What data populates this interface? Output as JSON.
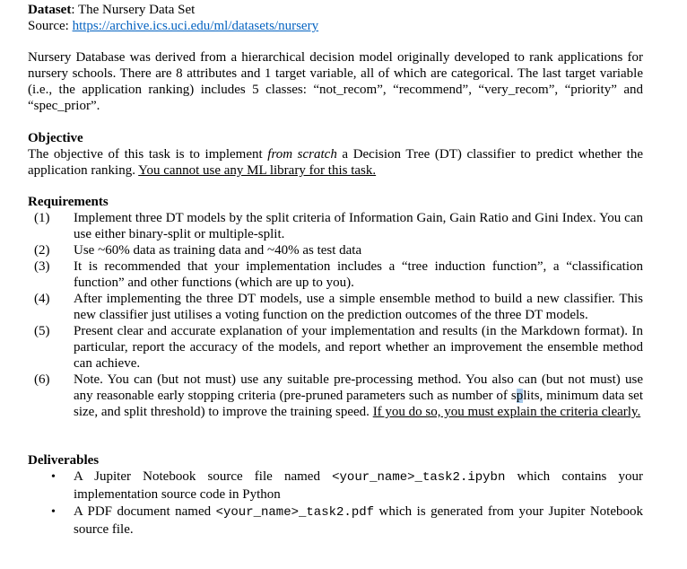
{
  "header": {
    "dataset_label": "Dataset",
    "dataset_value": ": The Nursery Data Set",
    "source_label": "Source: ",
    "source_url": "https://archive.ics.uci.edu/ml/datasets/nursery"
  },
  "intro": {
    "text": "Nursery Database was derived from a hierarchical decision model originally developed to rank applications for nursery schools. There are 8 attributes and 1 target variable, all of which are categorical. The last target variable (i.e., the application ranking) includes 5 classes: “not_recom”, “recommend”, “very_recom”, “priority” and “spec_prior”."
  },
  "objective": {
    "heading": "Objective",
    "text_before": "The objective of this task is to implement ",
    "text_italic": "from scratch",
    "text_after": " a Decision Tree (DT) classifier to predict whether the application ranking. ",
    "text_underlined": "You cannot use any ML library for this task."
  },
  "requirements": {
    "heading": "Requirements",
    "items": [
      {
        "num": "(1)",
        "text": "Implement three DT models by the split criteria of Information Gain, Gain Ratio and Gini Index. You can use either binary-split or multiple-split."
      },
      {
        "num": "(2)",
        "text": "Use ~60% data as training data and ~40% as test data"
      },
      {
        "num": "(3)",
        "text": "It is recommended that your implementation includes a “tree induction function”, a “classification function” and other functions (which are up to you)."
      },
      {
        "num": "(4)",
        "text": "After implementing the three DT models, use a simple ensemble method to build a new classifier. This new classifier just utilises a voting function on the prediction outcomes of the three DT models."
      },
      {
        "num": "(5)",
        "text": "Present clear and accurate explanation of your implementation and results (in the Markdown format). In particular, report the accuracy of the models, and report whether an improvement the ensemble method can achieve."
      },
      {
        "num": "(6)",
        "text_before_sel": "Note. You can (but not must) use any suitable pre-processing method. You also can (but not must) use any reasonable early stopping criteria (pre-pruned parameters such as number of s",
        "text_sel": "p",
        "text_after_sel": "lits, minimum data set size, and split threshold) to improve the training speed. ",
        "text_underlined": "If you do so, you must explain the criteria clearly."
      }
    ]
  },
  "deliverables": {
    "heading": "Deliverables",
    "items": [
      {
        "bullet": "•",
        "before": "A Jupiter Notebook source file named ",
        "code": "<your_name>_task2.ipybn",
        "after": " which contains your implementation source code in Python"
      },
      {
        "bullet": "•",
        "before": "A PDF document named ",
        "code": "<your_name>_task2.pdf",
        "after": " which is generated from your Jupiter Notebook source file."
      }
    ]
  }
}
